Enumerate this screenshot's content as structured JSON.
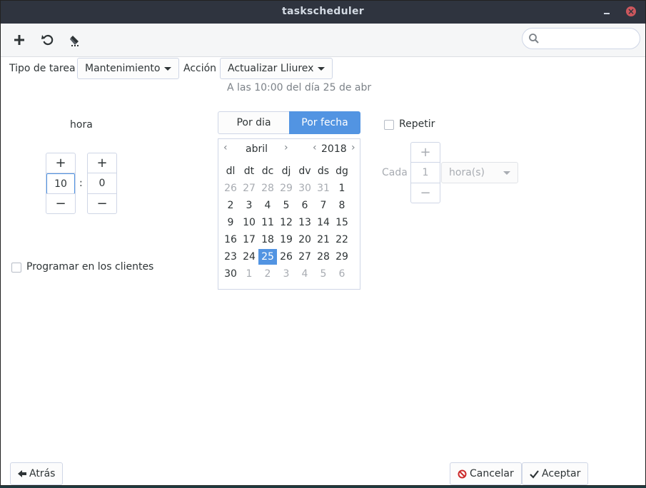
{
  "window": {
    "title": "taskscheduler",
    "minimize_glyph": "–",
    "close_glyph": "×"
  },
  "toolbar": {
    "add_icon": "plus-icon",
    "undo_icon": "undo-icon",
    "edit_icon": "brush-icon",
    "search": {
      "placeholder": "",
      "value": "",
      "icon": "search-icon"
    }
  },
  "form": {
    "task_type_label": "Tipo de tarea",
    "task_type_value": "Mantenimiento",
    "action_label": "Acción",
    "action_value": "Actualizar Lliurex",
    "schedule_info": "A las 10:00 del día 25 de abr"
  },
  "time": {
    "label": "hora",
    "hour": "10",
    "minute": "0",
    "separator": ":",
    "plus": "+",
    "minus": "−"
  },
  "mode_tabs": [
    {
      "label": "Por dia",
      "active": false
    },
    {
      "label": "Por fecha",
      "active": true
    }
  ],
  "calendar": {
    "month": "abril",
    "year": "2018",
    "prev": "‹",
    "next": "›",
    "weekdays": [
      "dl",
      "dt",
      "dc",
      "dj",
      "dv",
      "ds",
      "dg"
    ],
    "weeks": [
      [
        {
          "d": "26",
          "o": true
        },
        {
          "d": "27",
          "o": true
        },
        {
          "d": "28",
          "o": true
        },
        {
          "d": "29",
          "o": true
        },
        {
          "d": "30",
          "o": true
        },
        {
          "d": "31",
          "o": true
        },
        {
          "d": "1",
          "o": false
        }
      ],
      [
        {
          "d": "2",
          "o": false
        },
        {
          "d": "3",
          "o": false
        },
        {
          "d": "4",
          "o": false
        },
        {
          "d": "5",
          "o": false
        },
        {
          "d": "6",
          "o": false
        },
        {
          "d": "7",
          "o": false
        },
        {
          "d": "8",
          "o": false
        }
      ],
      [
        {
          "d": "9",
          "o": false
        },
        {
          "d": "10",
          "o": false
        },
        {
          "d": "11",
          "o": false
        },
        {
          "d": "12",
          "o": false
        },
        {
          "d": "13",
          "o": false
        },
        {
          "d": "14",
          "o": false
        },
        {
          "d": "15",
          "o": false
        }
      ],
      [
        {
          "d": "16",
          "o": false
        },
        {
          "d": "17",
          "o": false
        },
        {
          "d": "18",
          "o": false
        },
        {
          "d": "19",
          "o": false
        },
        {
          "d": "20",
          "o": false
        },
        {
          "d": "21",
          "o": false
        },
        {
          "d": "22",
          "o": false
        }
      ],
      [
        {
          "d": "23",
          "o": false
        },
        {
          "d": "24",
          "o": false
        },
        {
          "d": "25",
          "o": false,
          "sel": true
        },
        {
          "d": "26",
          "o": false
        },
        {
          "d": "27",
          "o": false
        },
        {
          "d": "28",
          "o": false
        },
        {
          "d": "29",
          "o": false
        }
      ],
      [
        {
          "d": "30",
          "o": false
        },
        {
          "d": "1",
          "o": true
        },
        {
          "d": "2",
          "o": true
        },
        {
          "d": "3",
          "o": true
        },
        {
          "d": "4",
          "o": true
        },
        {
          "d": "5",
          "o": true
        },
        {
          "d": "6",
          "o": true
        }
      ]
    ]
  },
  "repeat": {
    "label": "Repetir",
    "checked": false,
    "every_label": "Cada",
    "interval": "1",
    "unit": "hora(s)",
    "plus": "+",
    "minus": "−"
  },
  "clients": {
    "label": "Programar en los clientes",
    "checked": false
  },
  "footer": {
    "back_label": "Atrás",
    "cancel_label": "Cancelar",
    "accept_label": "Aceptar"
  },
  "colors": {
    "accent": "#5294e2",
    "titlebar": "#2f343f",
    "close": "#cc575d"
  }
}
